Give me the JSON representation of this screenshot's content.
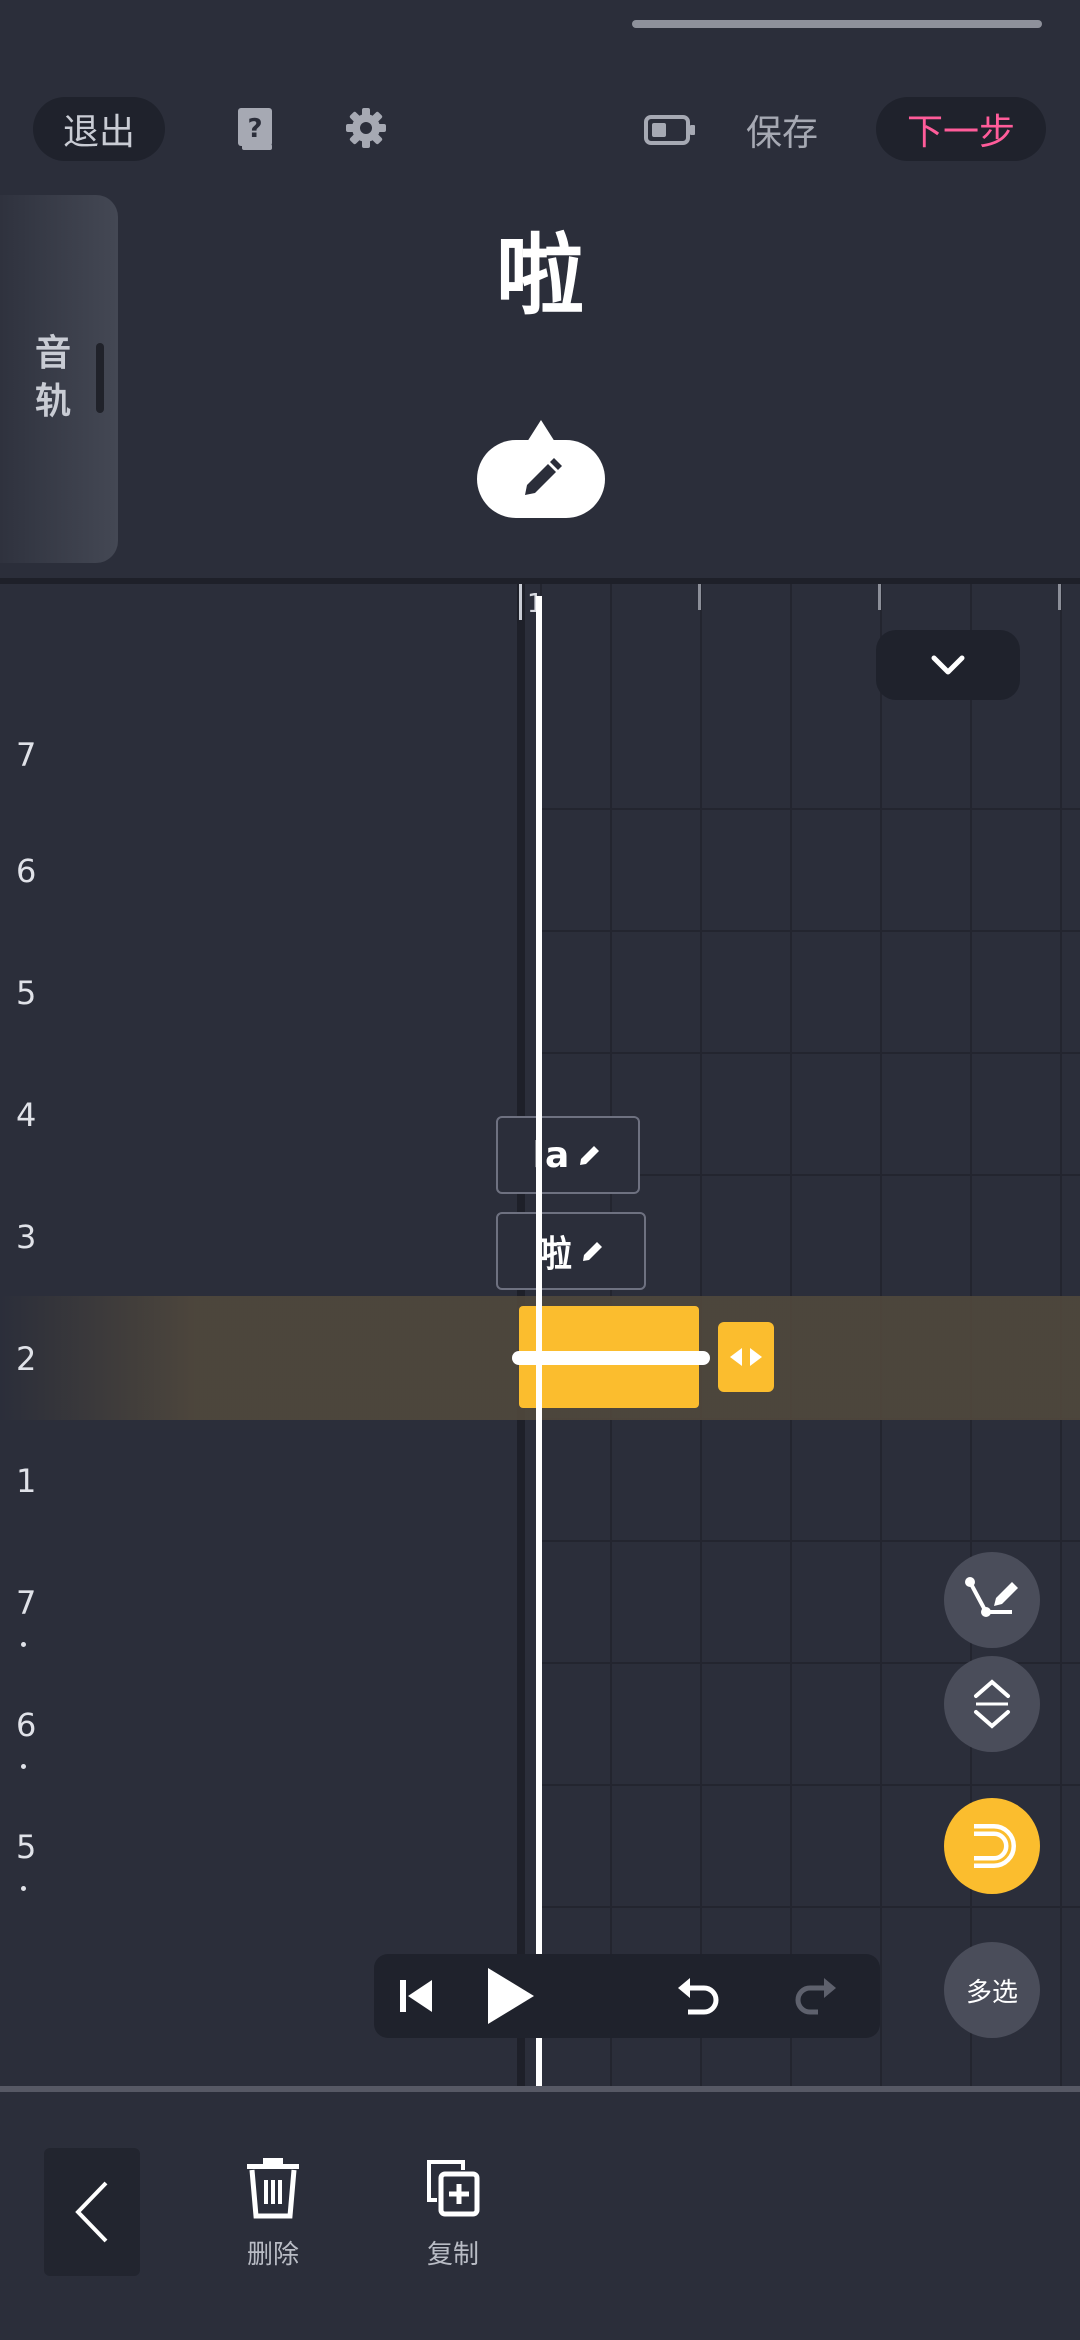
{
  "header": {
    "exit_label": "退出",
    "save_label": "保存",
    "next_label": "下一步",
    "help_icon": "help-book-icon",
    "settings_icon": "gear-icon",
    "battery_icon": "battery-icon"
  },
  "lyric": {
    "current_char": "啦"
  },
  "track_tab": {
    "label": "音轨"
  },
  "ruler": {
    "measure_number": "1"
  },
  "pitch_labels": [
    "7",
    "6",
    "5",
    "4",
    "3",
    "2",
    "1",
    "7",
    "6",
    "5"
  ],
  "note_labels": {
    "pinyin": "la",
    "character": "啦"
  },
  "side_tools": {
    "multi_select_label": "多选"
  },
  "bottom_bar": {
    "delete_label": "删除",
    "copy_label": "复制"
  },
  "colors": {
    "accent_pink": "#ff5c9a",
    "note_yellow": "#fbbd2e",
    "background": "#2b2e3a"
  }
}
